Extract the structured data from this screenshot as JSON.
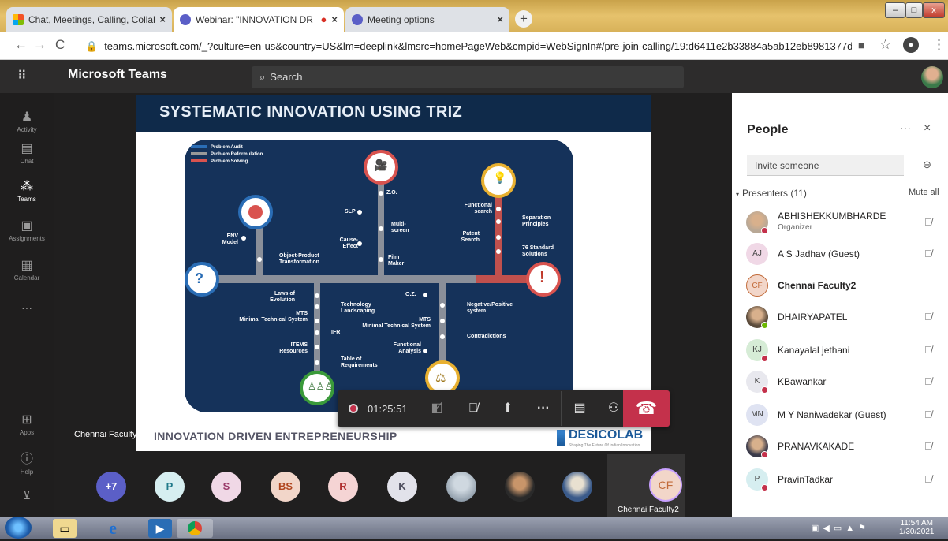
{
  "browser": {
    "tabs": [
      {
        "title": "Chat, Meetings, Calling, Collabor",
        "active": false
      },
      {
        "title": "Webinar: \"INNOVATION DR",
        "active": true
      },
      {
        "title": "Meeting options",
        "active": false
      }
    ],
    "url": "teams.microsoft.com/_?culture=en-us&country=US&lm=deeplink&lmsrc=homePageWeb&cmpid=WebSignIn#/pre-join-calling/19:d6411e2b33884a5ab12eb8981377d8ba..."
  },
  "teams": {
    "app_name": "Microsoft Teams",
    "search_placeholder": "Search",
    "rail": [
      {
        "label": "Activity",
        "icon": "bell-icon"
      },
      {
        "label": "Chat",
        "icon": "chat-icon"
      },
      {
        "label": "Teams",
        "icon": "teams-icon"
      },
      {
        "label": "Assignments",
        "icon": "assignments-icon"
      },
      {
        "label": "Calendar",
        "icon": "calendar-icon"
      }
    ],
    "rail_bottom": [
      {
        "label": "Apps",
        "icon": "apps-icon"
      },
      {
        "label": "Help",
        "icon": "help-icon"
      }
    ]
  },
  "slide": {
    "title": "SYSTEMATIC INNOVATION USING TRIZ",
    "footer": "INNOVATION DRIVEN ENTREPRENEURSHIP",
    "brand": "DESICOLAB",
    "brand_tagline": "Shaping The Future Of Indian Innovation",
    "presenter": "Chennai Faculty2",
    "legend": [
      "Problem Audit",
      "Problem Reformulation",
      "Problem Solving"
    ],
    "labels": {
      "zo": "Z.O.",
      "slp": "SLP",
      "multiscreen": "Multi-screen",
      "cause": "Cause-Effect",
      "film": "Film Maker",
      "fsearch": "Functional search",
      "sep": "Separation Principles",
      "patent": "Patent Search",
      "std": "76 Standard Solutions",
      "env": "ENV Model",
      "opt": "Object-Product Transformation",
      "laws": "Laws of Evolution",
      "tech": "Technology Landscaping",
      "mts": "MTS",
      "mtsfull": "Minimal Technical System",
      "ifr": "IFR",
      "items": "ITEMS",
      "resources": "Resources",
      "table": "Table of Requirements",
      "oz": "O.Z.",
      "negpos": "Negative/Positive system",
      "mts2": "MTS",
      "mts2full": "Minimal Technical System",
      "contra": "Contradictions",
      "fa": "Functional Analysis"
    }
  },
  "call": {
    "timer": "01:25:51",
    "buttons": [
      "camera-off-icon",
      "mic-off-icon",
      "share-icon",
      "more-icon",
      "chat-icon",
      "participants-icon"
    ]
  },
  "gallery": [
    {
      "initials": "+7",
      "bg": "#5b5fc7",
      "fg": "#ffffff"
    },
    {
      "initials": "P",
      "bg": "#d6eef0",
      "fg": "#217a8a"
    },
    {
      "initials": "S",
      "bg": "#f0d8e6",
      "fg": "#9a3a6a"
    },
    {
      "initials": "BS",
      "bg": "#f2d6c9",
      "fg": "#b0461e"
    },
    {
      "initials": "R",
      "bg": "#f5d4d4",
      "fg": "#b03030"
    },
    {
      "initials": "K",
      "bg": "#e2e2ea",
      "fg": "#505060"
    }
  ],
  "self_tile": {
    "initials": "CF",
    "name": "Chennai Faculty2"
  },
  "people_panel": {
    "title": "People",
    "invite_placeholder": "Invite someone",
    "section": "Presenters (11)",
    "mute_all": "Mute all",
    "people": [
      {
        "name": "ABHISHEKKUMBHARDE",
        "sub": "Organizer",
        "initials": "",
        "photo": true,
        "bg": "#b8a896",
        "status": "#c4314b",
        "mic": true,
        "bold": false
      },
      {
        "name": "A S Jadhav (Guest)",
        "sub": "",
        "initials": "AJ",
        "photo": false,
        "bg": "#f0d8e6",
        "status": "",
        "mic": true,
        "bold": false
      },
      {
        "name": "Chennai Faculty2",
        "sub": "",
        "initials": "CF",
        "photo": false,
        "bg": "#f2d6c9",
        "status": "",
        "mic": false,
        "bold": true
      },
      {
        "name": "DHAIRYAPATEL",
        "sub": "",
        "initials": "",
        "photo": true,
        "bg": "#5a4a3a",
        "status": "#6bb700",
        "mic": true,
        "bold": false
      },
      {
        "name": "Kanayalal jethani",
        "sub": "",
        "initials": "KJ",
        "photo": false,
        "bg": "#d6ecd6",
        "status": "#c4314b",
        "mic": true,
        "bold": false
      },
      {
        "name": "KBawankar",
        "sub": "",
        "initials": "K",
        "photo": false,
        "bg": "#e8e8ee",
        "status": "#c4314b",
        "mic": true,
        "bold": false
      },
      {
        "name": "M Y Naniwadekar (Guest)",
        "sub": "",
        "initials": "MN",
        "photo": false,
        "bg": "#dfe3f2",
        "status": "",
        "mic": true,
        "bold": false
      },
      {
        "name": "PRANAVKAKADE",
        "sub": "",
        "initials": "",
        "photo": true,
        "bg": "#3a3a4a",
        "status": "#c4314b",
        "mic": true,
        "bold": false
      },
      {
        "name": "PravinTadkar",
        "sub": "",
        "initials": "P",
        "photo": false,
        "bg": "#d6eef0",
        "status": "#c4314b",
        "mic": true,
        "bold": false
      }
    ]
  },
  "taskbar": {
    "time": "11:54 AM",
    "date": "1/30/2021"
  }
}
